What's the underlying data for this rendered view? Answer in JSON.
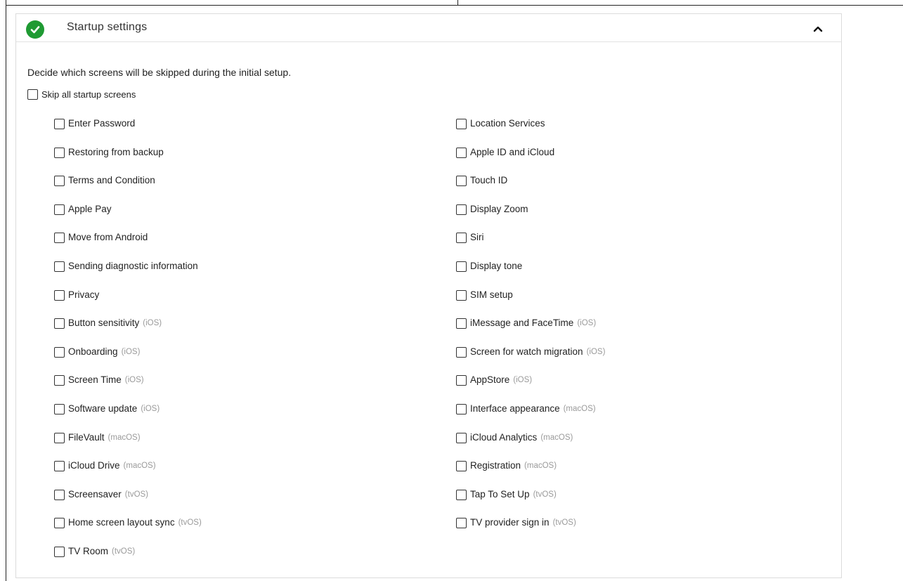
{
  "panel": {
    "title": "Startup settings",
    "description": "Decide which screens will be skipped during the initial setup.",
    "skip_all_label": "Skip all startup screens",
    "status_color": "#1f9a33",
    "status_icon": "check-circle-icon",
    "collapse_icon": "chevron-up-icon"
  },
  "options_left": [
    {
      "label": "Enter Password",
      "platform": ""
    },
    {
      "label": "Restoring from backup",
      "platform": ""
    },
    {
      "label": "Terms and Condition",
      "platform": ""
    },
    {
      "label": "Apple Pay",
      "platform": ""
    },
    {
      "label": "Move from Android",
      "platform": ""
    },
    {
      "label": "Sending diagnostic information",
      "platform": ""
    },
    {
      "label": "Privacy",
      "platform": ""
    },
    {
      "label": "Button sensitivity",
      "platform": "(iOS)"
    },
    {
      "label": "Onboarding",
      "platform": "(iOS)"
    },
    {
      "label": "Screen Time",
      "platform": "(iOS)"
    },
    {
      "label": "Software update",
      "platform": "(iOS)"
    },
    {
      "label": "FileVault",
      "platform": "(macOS)"
    },
    {
      "label": "iCloud Drive",
      "platform": "(macOS)"
    },
    {
      "label": "Screensaver",
      "platform": "(tvOS)"
    },
    {
      "label": "Home screen layout sync",
      "platform": "(tvOS)"
    },
    {
      "label": "TV Room",
      "platform": "(tvOS)"
    }
  ],
  "options_right": [
    {
      "label": "Location Services",
      "platform": ""
    },
    {
      "label": "Apple ID and iCloud",
      "platform": ""
    },
    {
      "label": "Touch ID",
      "platform": ""
    },
    {
      "label": "Display Zoom",
      "platform": ""
    },
    {
      "label": "Siri",
      "platform": ""
    },
    {
      "label": "Display tone",
      "platform": ""
    },
    {
      "label": "SIM setup",
      "platform": ""
    },
    {
      "label": "iMessage and FaceTime",
      "platform": "(iOS)"
    },
    {
      "label": "Screen for watch migration",
      "platform": "(iOS)"
    },
    {
      "label": "AppStore",
      "platform": "(iOS)"
    },
    {
      "label": "Interface appearance",
      "platform": "(macOS)"
    },
    {
      "label": "iCloud Analytics",
      "platform": "(macOS)"
    },
    {
      "label": "Registration",
      "platform": "(macOS)"
    },
    {
      "label": "Tap To Set Up",
      "platform": "(tvOS)"
    },
    {
      "label": "TV provider sign in",
      "platform": "(tvOS)"
    }
  ]
}
